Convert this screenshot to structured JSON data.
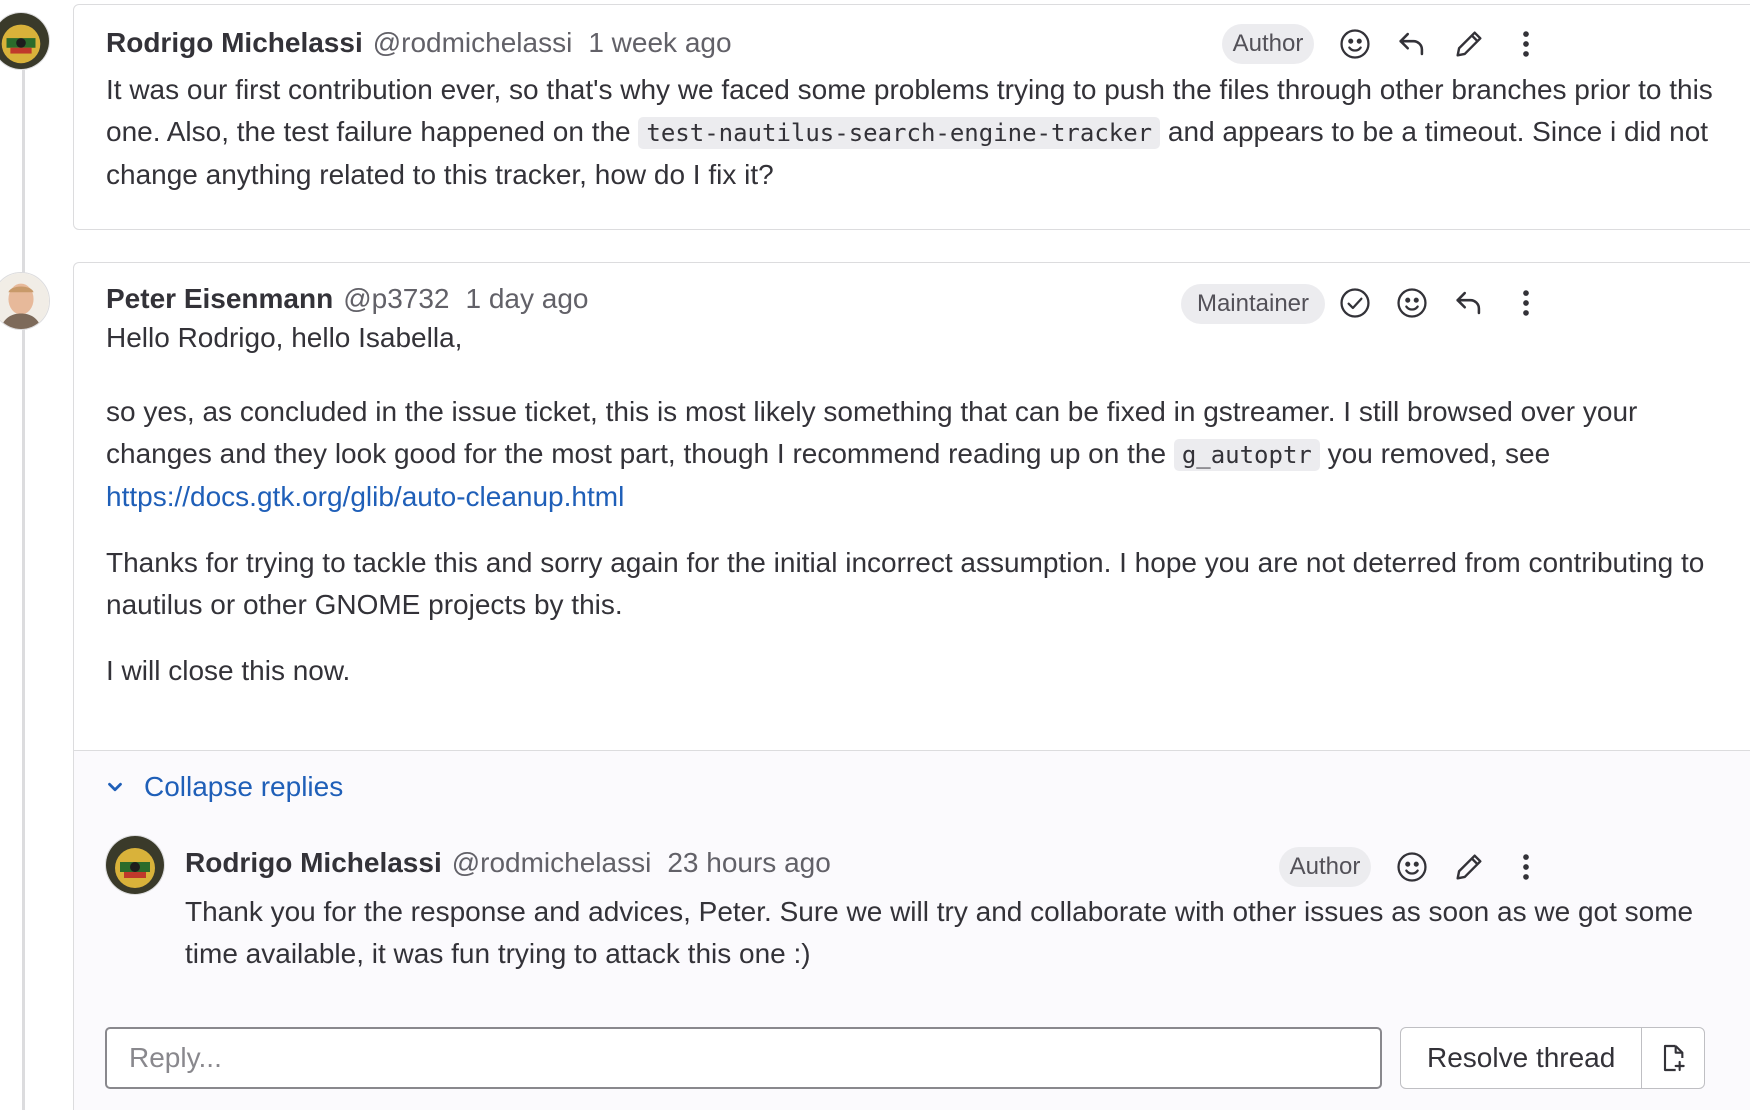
{
  "colors": {
    "link": "#1f5fb8",
    "badge_bg": "#ececef",
    "border": "#dcdcde",
    "text": "#333238",
    "muted": "#626168"
  },
  "notes": [
    {
      "author": "Rodrigo Michelassi",
      "handle": "@rodmichelassi",
      "time": "1 week ago",
      "role": "Author",
      "actions": [
        "smiley-icon",
        "reply-icon",
        "pencil-icon",
        "more-vertical-icon"
      ],
      "body": {
        "text_1": "It was our first contribution ever, so that's why we faced some problems trying to push the files through other branches prior to this one. Also, the test failure happened on the ",
        "code_1": "test-nautilus-search-engine-tracker",
        "text_2": " and appears to be a timeout. Since i did not change anything related to this tracker, how do I fix it?"
      }
    },
    {
      "author": "Peter Eisenmann",
      "handle": "@p3732",
      "time": "1 day ago",
      "role": "Maintainer",
      "actions": [
        "check-circle-icon",
        "smiley-icon",
        "reply-icon",
        "more-vertical-icon"
      ],
      "body": {
        "para_1": "Hello Rodrigo, hello Isabella,",
        "para_2_text_1": "so yes, as concluded in the issue ticket, this is most likely something that can be fixed in gstreamer. I still browsed over your changes and they look good for the most part, though I recommend reading up on the ",
        "para_2_code": "g_autoptr",
        "para_2_text_2": " you removed, see ",
        "para_2_link": "https://docs.gtk.org/glib/auto-cleanup.html",
        "para_3": "Thanks for trying to tackle this and sorry again for the initial incorrect assumption. I hope you are not deterred from contributing to nautilus or other GNOME projects by this.",
        "para_4": "I will close this now."
      }
    }
  ],
  "replies": {
    "collapse_label": "Collapse replies",
    "items": [
      {
        "author": "Rodrigo Michelassi",
        "handle": "@rodmichelassi",
        "time": "23 hours ago",
        "role": "Author",
        "actions": [
          "smiley-icon",
          "pencil-icon",
          "more-vertical-icon"
        ],
        "body": "Thank you for the response and advices, Peter. Sure we will try and collaborate with other issues as soon as we got some time available, it was fun trying to attack this one :)"
      }
    ],
    "reply_placeholder": "Reply...",
    "resolve_label": "Resolve thread",
    "issue_icon": "create-issue-icon"
  }
}
